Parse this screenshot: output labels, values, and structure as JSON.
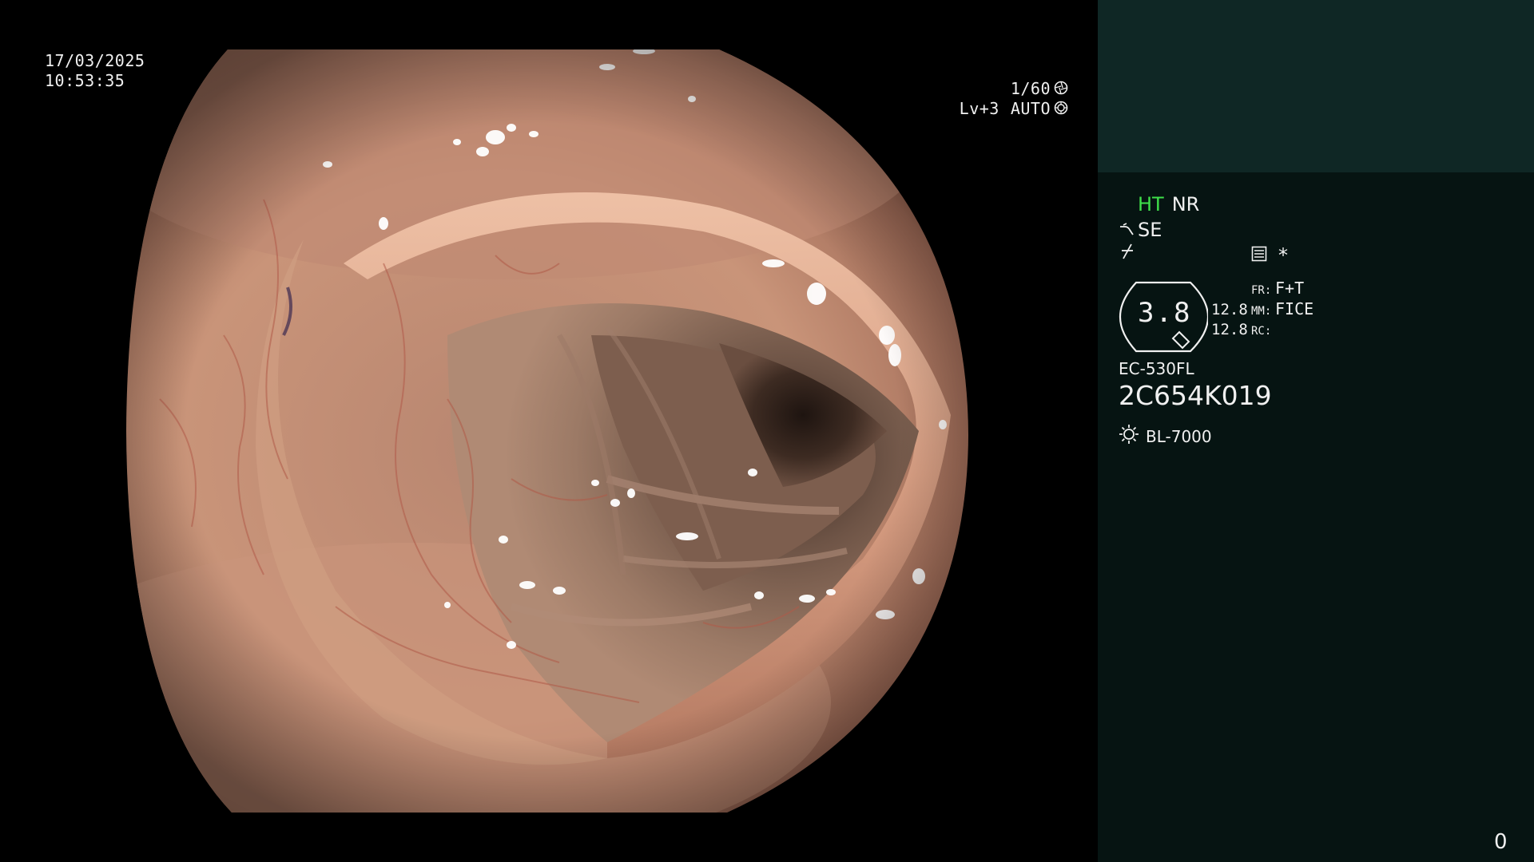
{
  "overlay": {
    "date": "17/03/2025",
    "time": "10:53:35",
    "shutter": "1/60",
    "shutter_icon": "aperture-icon",
    "level": "Lv+3",
    "exposure_mode": "AUTO",
    "exposure_icon": "iris-icon"
  },
  "panel": {
    "mode_ht": "HT",
    "mode_nr": "NR",
    "structure_enhancement": "SE",
    "memo_mark": "*",
    "zoom_value": "3.8",
    "settings": [
      {
        "num": "",
        "key": "FR:",
        "value": "F+T"
      },
      {
        "num": "12.8",
        "key": "MM:",
        "value": "FICE"
      },
      {
        "num": "12.8",
        "key": "RC:",
        "value": ""
      }
    ],
    "scope_model": "EC-530FL",
    "scope_serial": "2C654K019",
    "light_source": "BL-7000",
    "page_counter": "0"
  },
  "colors": {
    "background": "#000000",
    "panel_top": "#0f2725",
    "panel_bottom": "#061412",
    "ht_green": "#3fe04a",
    "text": "#f0f0f0"
  }
}
